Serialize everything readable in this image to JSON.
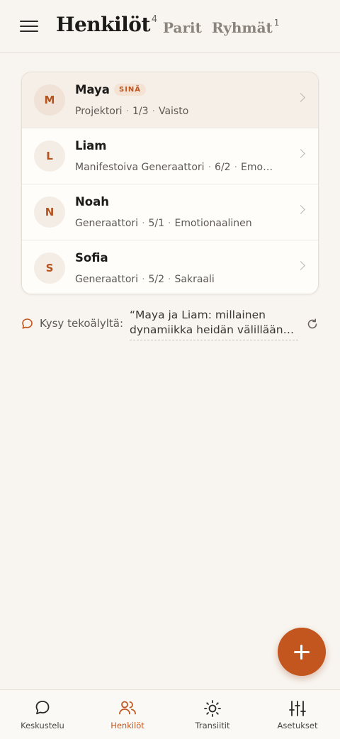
{
  "header": {
    "tabs": [
      {
        "label": "Henkilöt",
        "count": "4"
      },
      {
        "label": "Parit"
      },
      {
        "label": "Ryhmät",
        "count": "1"
      }
    ]
  },
  "people": [
    {
      "initial": "M",
      "name": "Maya",
      "badge": "SINÄ",
      "type": "Projektori",
      "profile": "1/3",
      "authority": "Vaisto"
    },
    {
      "initial": "L",
      "name": "Liam",
      "type": "Manifestoiva Generaattori",
      "profile": "6/2",
      "authority": "Emo…"
    },
    {
      "initial": "N",
      "name": "Noah",
      "type": "Generaattori",
      "profile": "5/1",
      "authority": "Emotionaalinen"
    },
    {
      "initial": "S",
      "name": "Sofia",
      "type": "Generaattori",
      "profile": "5/2",
      "authority": "Sakraali"
    }
  ],
  "ai": {
    "label": "Kysy tekoälyltä:",
    "prompt": "“Maya ja Liam: millainen dynamiikka heidän välillään…"
  },
  "bottom_nav": [
    {
      "label": "Keskustelu",
      "icon": "chat-icon"
    },
    {
      "label": "Henkilöt",
      "icon": "people-icon",
      "active": true
    },
    {
      "label": "Transiitit",
      "icon": "sun-icon"
    },
    {
      "label": "Asetukset",
      "icon": "sliders-icon"
    }
  ],
  "colors": {
    "accent": "#c2561e",
    "background": "#f8f5f0"
  }
}
